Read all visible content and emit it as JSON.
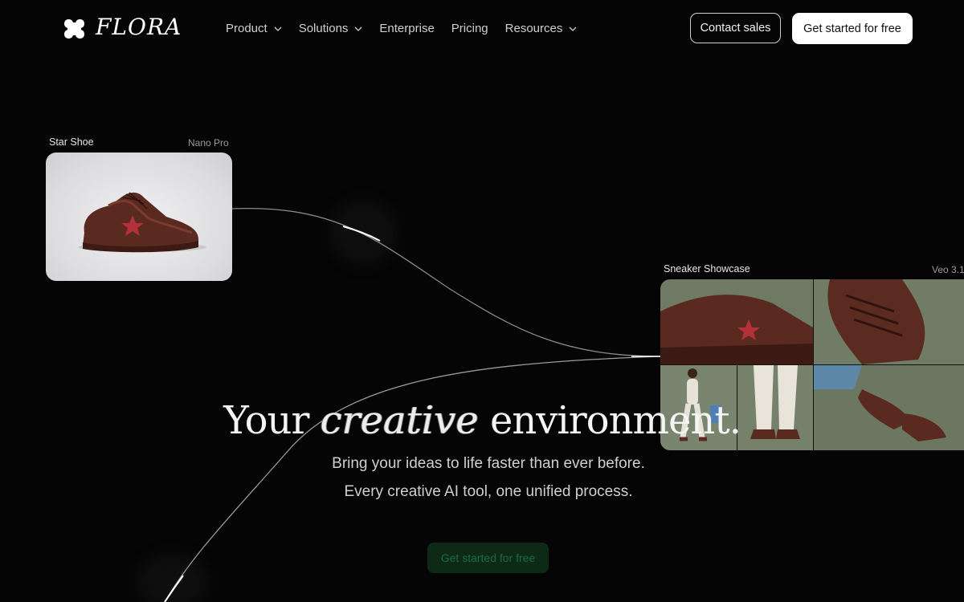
{
  "brand": {
    "name": "FLORA"
  },
  "nav": {
    "items": [
      {
        "label": "Product",
        "has_dropdown": true
      },
      {
        "label": "Solutions",
        "has_dropdown": true
      },
      {
        "label": "Enterprise",
        "has_dropdown": false
      },
      {
        "label": "Pricing",
        "has_dropdown": false
      },
      {
        "label": "Resources",
        "has_dropdown": true
      }
    ],
    "contact_label": "Contact sales",
    "start_label": "Get started for free"
  },
  "nodes": {
    "star_shoe": {
      "title": "Star Shoe",
      "model": "Nano Pro"
    },
    "sneaker_showcase": {
      "title": "Sneaker Showcase",
      "model": "Veo 3.1"
    }
  },
  "hero": {
    "title_before": "Your",
    "title_emphasis": "creative",
    "title_after": "environment.",
    "subtitle_line1": "Bring your ideas to life faster than ever before.",
    "subtitle_line2": "Every creative AI tool, one unified process.",
    "cta_label": "Get started for free"
  },
  "colors": {
    "background": "#050505",
    "button_primary_bg": "#ffffff",
    "cta_ghost_bg": "#0d2a17",
    "shoe_brown": "#5a2a20",
    "showcase_green": "#76806a"
  }
}
